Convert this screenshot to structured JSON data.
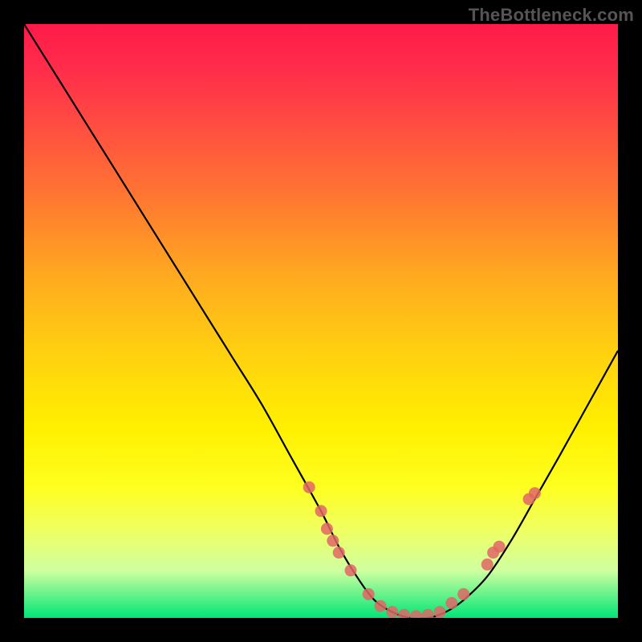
{
  "watermark": "TheBottleneck.com",
  "chart_data": {
    "type": "line",
    "title": "",
    "xlabel": "",
    "ylabel": "",
    "xlim": [
      0,
      100
    ],
    "ylim": [
      0,
      100
    ],
    "series": [
      {
        "name": "bottleneck-curve",
        "x": [
          0,
          5,
          10,
          15,
          20,
          25,
          30,
          35,
          40,
          45,
          50,
          53,
          56,
          59,
          62,
          65,
          68,
          71,
          74,
          78,
          82,
          86,
          90,
          95,
          100
        ],
        "y": [
          100,
          92,
          84,
          76,
          68,
          60,
          52,
          44,
          36,
          27,
          18,
          12,
          7,
          3,
          1,
          0,
          0,
          1,
          3,
          7,
          13,
          20,
          27,
          36,
          45
        ]
      }
    ],
    "markers": {
      "name": "highlight-dots",
      "points": [
        {
          "x": 48,
          "y": 22
        },
        {
          "x": 50,
          "y": 18
        },
        {
          "x": 51,
          "y": 15
        },
        {
          "x": 52,
          "y": 13
        },
        {
          "x": 53,
          "y": 11
        },
        {
          "x": 55,
          "y": 8
        },
        {
          "x": 58,
          "y": 4
        },
        {
          "x": 60,
          "y": 2
        },
        {
          "x": 62,
          "y": 1
        },
        {
          "x": 64,
          "y": 0.5
        },
        {
          "x": 66,
          "y": 0.3
        },
        {
          "x": 68,
          "y": 0.5
        },
        {
          "x": 70,
          "y": 1
        },
        {
          "x": 72,
          "y": 2.5
        },
        {
          "x": 74,
          "y": 4
        },
        {
          "x": 78,
          "y": 9
        },
        {
          "x": 79,
          "y": 11
        },
        {
          "x": 80,
          "y": 12
        },
        {
          "x": 85,
          "y": 20
        },
        {
          "x": 86,
          "y": 21
        }
      ]
    }
  }
}
